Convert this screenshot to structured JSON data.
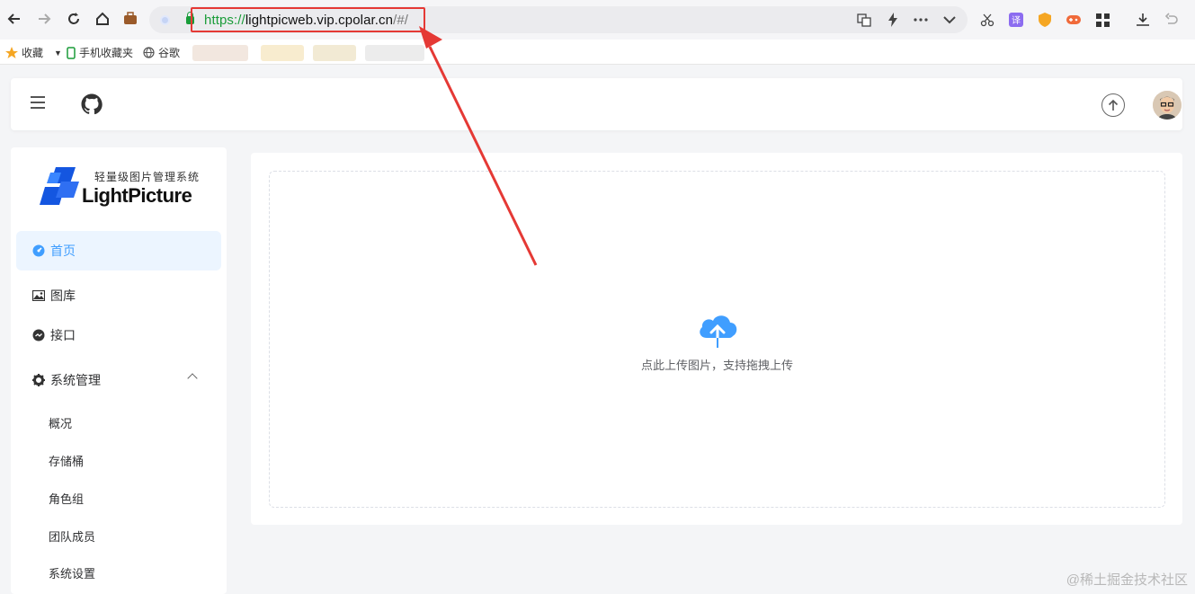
{
  "browser": {
    "url_scheme": "https://",
    "url_host": "lightpicweb.vip.cpolar.cn",
    "url_path": "/#/",
    "bookmarks": [
      {
        "label": "收藏",
        "icon": "star-icon"
      },
      {
        "label": "手机收藏夹",
        "icon": "phone-icon"
      },
      {
        "label": "谷歌",
        "icon": "globe-icon"
      }
    ]
  },
  "sidebar": {
    "logo_subtitle": "轻量级图片管理系统",
    "logo_title": "LightPicture",
    "items": [
      {
        "label": "首页",
        "icon": "dashboard-icon",
        "active": true
      },
      {
        "label": "图库",
        "icon": "image-icon"
      },
      {
        "label": "接口",
        "icon": "api-icon"
      },
      {
        "label": "系统管理",
        "icon": "gear-icon"
      }
    ],
    "sub_items": [
      "概况",
      "存储桶",
      "角色组",
      "团队成员",
      "系统设置"
    ]
  },
  "main": {
    "upload_hint": "点此上传图片，支持拖拽上传"
  },
  "watermark": "@稀土掘金技术社区",
  "colors": {
    "accent": "#409eff",
    "annotation": "#e53935",
    "url_green": "#1a9c39"
  }
}
